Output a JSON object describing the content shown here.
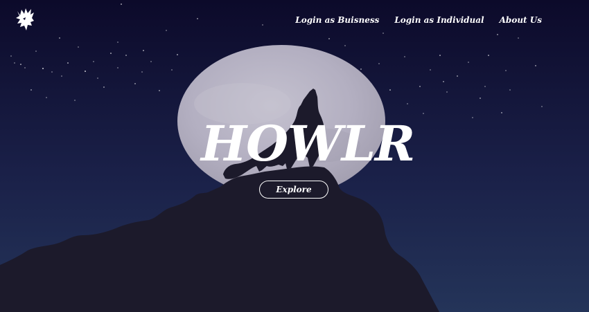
{
  "brand": {
    "icon": "wolf-head-icon"
  },
  "nav": {
    "items": [
      {
        "label": "Login as Buisness"
      },
      {
        "label": "Login as Individual"
      },
      {
        "label": "About Us"
      }
    ]
  },
  "hero": {
    "title": "HOWLR",
    "cta_label": "Explore"
  },
  "colors": {
    "sky_top": "#0c0a2a",
    "sky_bottom": "#243459",
    "moon": "#b6b2c3",
    "silhouette": "#1c1a2b",
    "text": "#ffffff"
  }
}
